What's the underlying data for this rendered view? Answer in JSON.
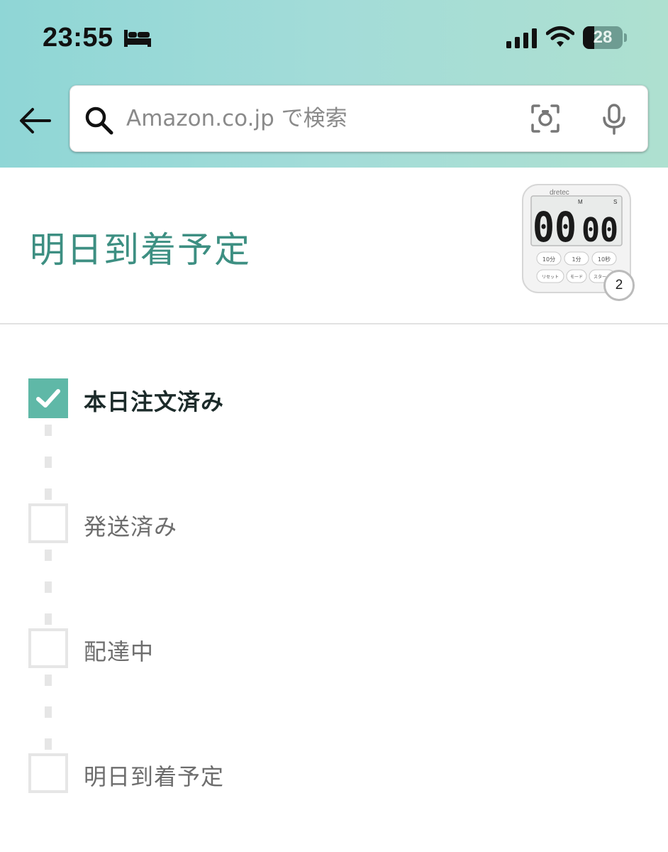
{
  "status_bar": {
    "time": "23:55",
    "focus_icon": "bed-icon",
    "battery_level": "28"
  },
  "search": {
    "placeholder": "Amazon.co.jp で検索",
    "value": ""
  },
  "page": {
    "title": "明日到着予定"
  },
  "product": {
    "quantity_badge": "2",
    "thumbnail_digits": "00",
    "thumbnail_seconds": "00",
    "thumbnail_brand": "dretec",
    "thumbnail_buttons": [
      "10分",
      "1分",
      "10秒",
      "リセット",
      "モード",
      "スタート"
    ]
  },
  "tracking_steps": [
    {
      "label": "本日注文済み",
      "completed": true
    },
    {
      "label": "発送済み",
      "completed": false
    },
    {
      "label": "配達中",
      "completed": false
    },
    {
      "label": "明日到着予定",
      "completed": false
    }
  ],
  "colors": {
    "accent": "#3d8f82",
    "completed_check": "#5fb8a7",
    "header_gradient_start": "#8fd6d6",
    "header_gradient_end": "#aee0d0"
  }
}
